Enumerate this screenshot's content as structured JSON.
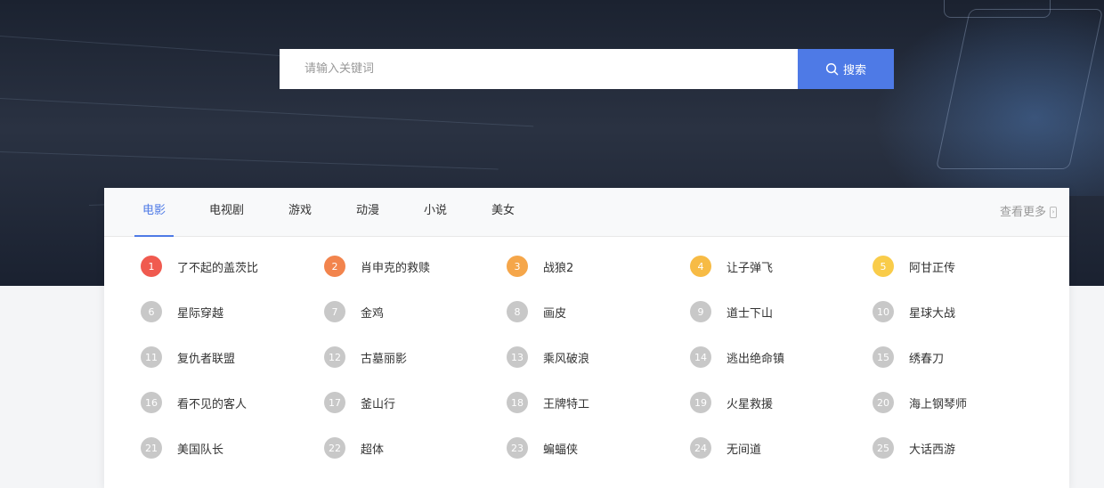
{
  "search": {
    "placeholder": "请输入关键词",
    "button_label": "搜索"
  },
  "tabs": [
    {
      "label": "电影",
      "active": true
    },
    {
      "label": "电视剧",
      "active": false
    },
    {
      "label": "游戏",
      "active": false
    },
    {
      "label": "动漫",
      "active": false
    },
    {
      "label": "小说",
      "active": false
    },
    {
      "label": "美女",
      "active": false
    }
  ],
  "more_label": "查看更多",
  "colors": {
    "accent": "#4e7ae6",
    "rank1": "#f05a4f",
    "rank2": "#f2844d",
    "rank3": "#f5a64a",
    "rank4": "#f7bb45",
    "rank5": "#f9cc4a",
    "rank_default": "#c8c8c8"
  },
  "rankings": [
    {
      "rank": "1",
      "title": "了不起的盖茨比"
    },
    {
      "rank": "2",
      "title": "肖申克的救赎"
    },
    {
      "rank": "3",
      "title": "战狼2"
    },
    {
      "rank": "4",
      "title": "让子弹飞"
    },
    {
      "rank": "5",
      "title": "阿甘正传"
    },
    {
      "rank": "6",
      "title": "星际穿越"
    },
    {
      "rank": "7",
      "title": "金鸡"
    },
    {
      "rank": "8",
      "title": "画皮"
    },
    {
      "rank": "9",
      "title": "道士下山"
    },
    {
      "rank": "10",
      "title": "星球大战"
    },
    {
      "rank": "11",
      "title": "复仇者联盟"
    },
    {
      "rank": "12",
      "title": "古墓丽影"
    },
    {
      "rank": "13",
      "title": "乘风破浪"
    },
    {
      "rank": "14",
      "title": "逃出绝命镇"
    },
    {
      "rank": "15",
      "title": "绣春刀"
    },
    {
      "rank": "16",
      "title": "看不见的客人"
    },
    {
      "rank": "17",
      "title": "釜山行"
    },
    {
      "rank": "18",
      "title": "王牌特工"
    },
    {
      "rank": "19",
      "title": "火星救援"
    },
    {
      "rank": "20",
      "title": "海上钢琴师"
    },
    {
      "rank": "21",
      "title": "美国队长"
    },
    {
      "rank": "22",
      "title": "超体"
    },
    {
      "rank": "23",
      "title": "蝙蝠侠"
    },
    {
      "rank": "24",
      "title": "无间道"
    },
    {
      "rank": "25",
      "title": "大话西游"
    }
  ]
}
